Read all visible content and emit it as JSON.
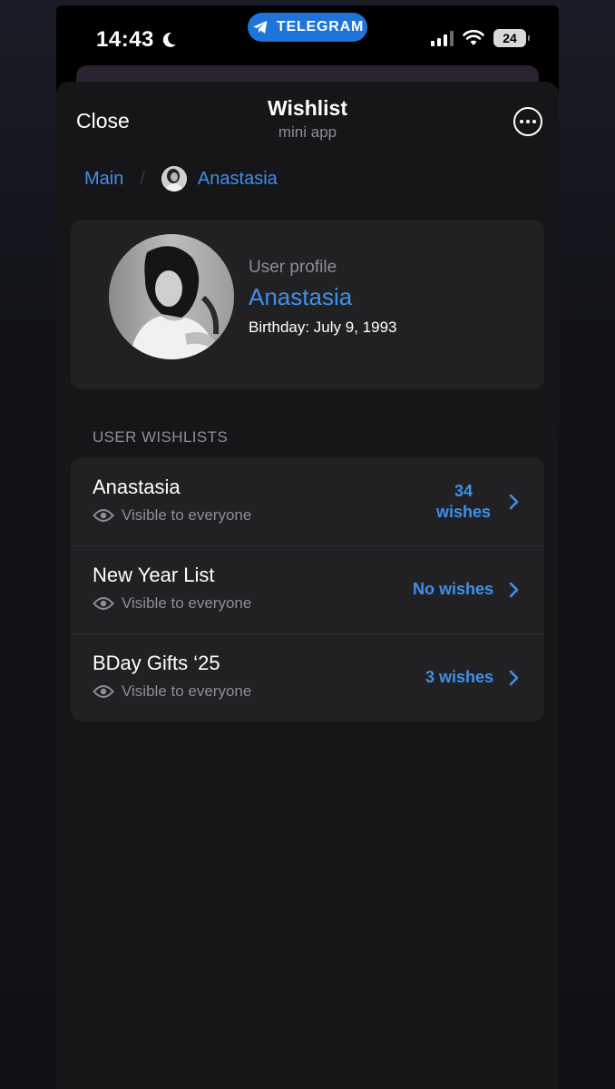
{
  "status_bar": {
    "time": "14:43",
    "pill_label": "TELEGRAM",
    "battery": "24",
    "icons": [
      "moon-icon",
      "telegram-icon",
      "signal-icon",
      "wifi-icon",
      "battery-icon"
    ]
  },
  "header": {
    "close_label": "Close",
    "title": "Wishlist",
    "subtitle": "mini app"
  },
  "breadcrumb": {
    "root": "Main",
    "current": "Anastasia"
  },
  "profile": {
    "kicker": "User profile",
    "name": "Anastasia",
    "birthday": "Birthday: July 9, 1993"
  },
  "wishlists": {
    "section_label": "USER WISHLISTS",
    "items": [
      {
        "title": "Anastasia",
        "visibility": "Visible to everyone",
        "count_line1": "34",
        "count_line2": "wishes"
      },
      {
        "title": "New Year List",
        "visibility": "Visible to everyone",
        "count": "No wishes"
      },
      {
        "title": "BDay Gifts ‘25",
        "visibility": "Visible to everyone",
        "count": "3 wishes"
      }
    ]
  },
  "colors": {
    "accent": "#3e91ea",
    "telegram_pill": "#1e74d8",
    "sheet_bg": "#161619",
    "card_bg": "#212124",
    "secondary_text": "#8e8e93"
  }
}
